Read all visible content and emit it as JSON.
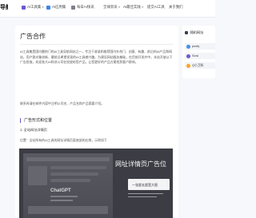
{
  "nav": {
    "logo": "导航",
    "items": [
      {
        "label": "AI工具集",
        "icon": "grid-icon",
        "dropdown": true
      },
      {
        "label": "AI应用集",
        "icon": "apps-icon",
        "dropdown": false
      },
      {
        "label": "每日AI快讯",
        "icon": "news-icon",
        "dropdown": false
      },
      {
        "label": "全球资讯",
        "icon": "",
        "dropdown": true
      },
      {
        "label": "AI最佳实践",
        "icon": "",
        "dropdown": true
      },
      {
        "label": "提交AI工具",
        "icon": "",
        "dropdown": false
      },
      {
        "label": "关于我们",
        "icon": "",
        "dropdown": false
      }
    ]
  },
  "article": {
    "title": "广告合作",
    "intro": "AI工具集是国内最热门的AI工具导航网站之一，专注于收录和推荐国内外热门、创意、有趣、前沿的AI产品和网站，用户群对象创新、最前沿希望发现的AI工具感兴趣。为建设网站服务基础，在目前开发并中，本站开放以下广告投放，欢迎各大AI科技公司在投放给您产品，让您更好的产品方案找到客户群体。",
    "contact": "联系时请在邮件内容中注明公司名、产品名和产品简要介绍。",
    "section_heading": "广告形式和位置",
    "sub_heading": "1. 全站网址详情页",
    "position": "位置：全站所有的AI工具的网址详情页面底部的右侧，示例如下"
  },
  "banner": {
    "title": "网址详情页广告位",
    "ad_box_label": "一张超长超宽大图",
    "mock_app_name": "ChatGPT"
  },
  "sidebar": {
    "heading": "随机网址",
    "items": [
      {
        "label": "poofy",
        "icon_color": "#4a90e2"
      },
      {
        "label": "Sora",
        "icon_color": "#6a5acd"
      },
      {
        "label": "Q小卫科",
        "icon_color": "#f5a623"
      }
    ]
  },
  "colors": {
    "accent": "#6a5acd",
    "background": "#f7f8fb"
  }
}
